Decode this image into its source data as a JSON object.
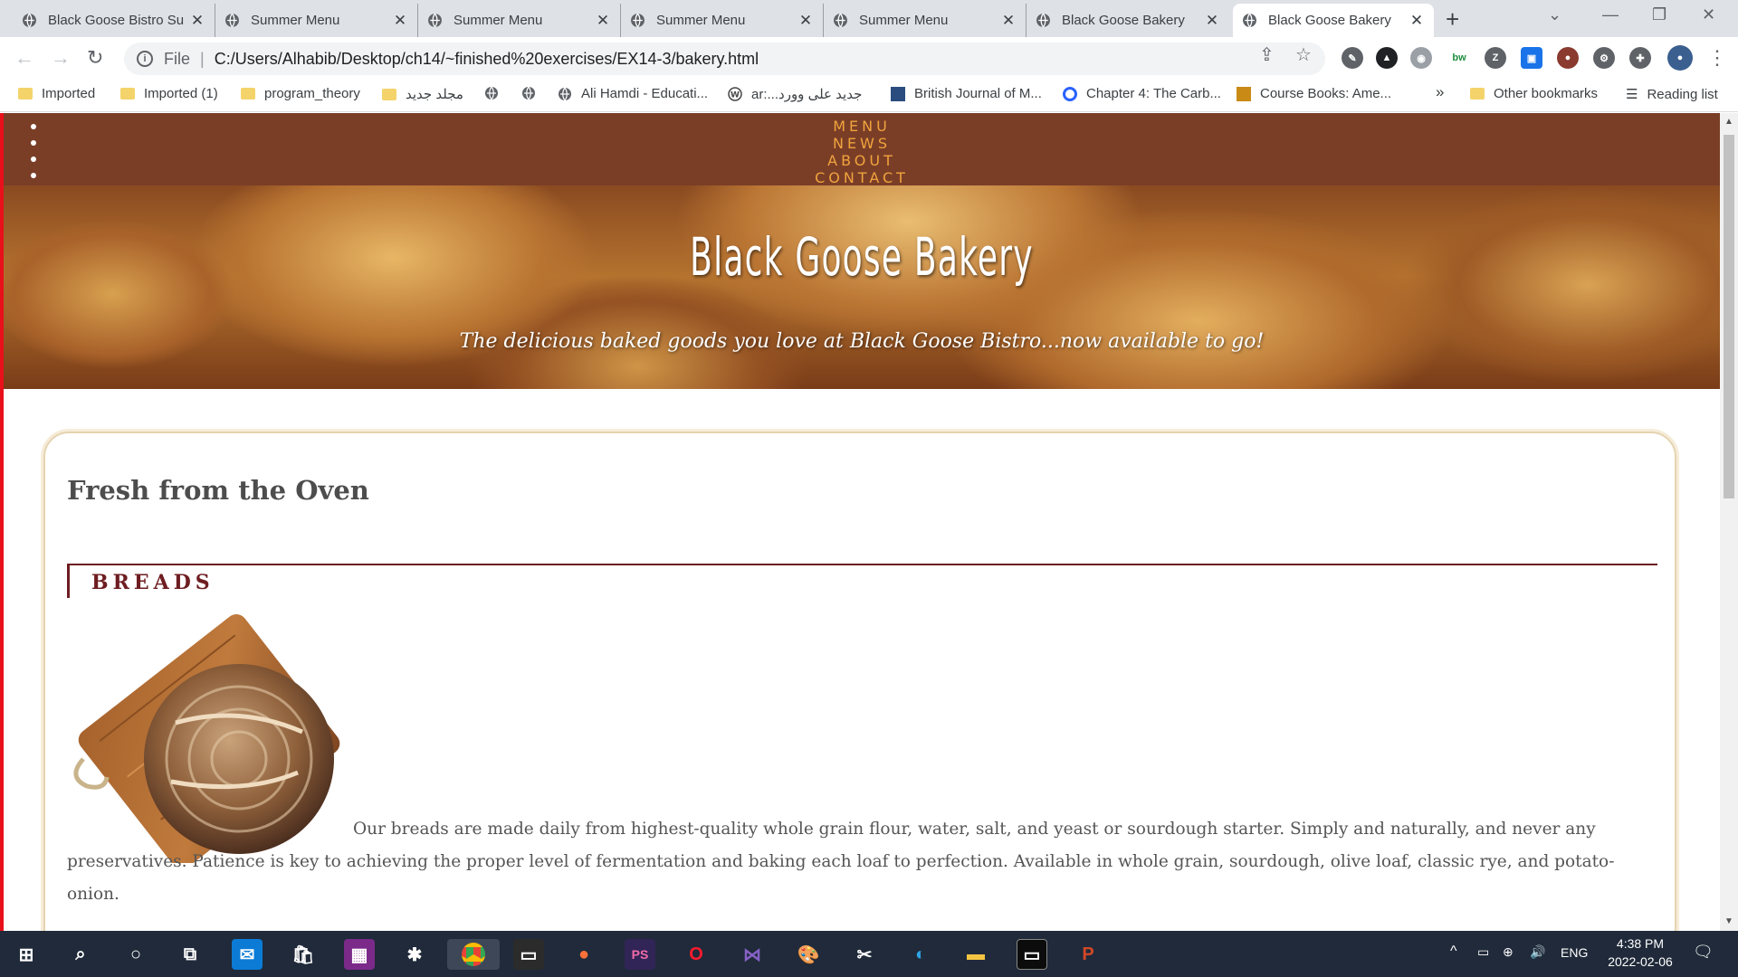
{
  "browser": {
    "tabs": [
      {
        "title": "Black Goose Bistro Su",
        "active": false
      },
      {
        "title": "Summer Menu",
        "active": false
      },
      {
        "title": "Summer Menu",
        "active": false
      },
      {
        "title": "Summer Menu",
        "active": false
      },
      {
        "title": "Summer Menu",
        "active": false
      },
      {
        "title": "Black Goose Bakery",
        "active": false
      },
      {
        "title": "Black Goose Bakery",
        "active": true
      }
    ],
    "new_tab_label": "+",
    "address": {
      "scheme_label": "File",
      "url": "C:/Users/Alhabib/Desktop/ch14/~finished%20exercises/EX14-3/bakery.html"
    },
    "bookmarks": [
      {
        "label": "Imported",
        "type": "folder"
      },
      {
        "label": "Imported (1)",
        "type": "folder"
      },
      {
        "label": "program_theory",
        "type": "folder"
      },
      {
        "label": "مجلد جديد",
        "type": "folder"
      },
      {
        "label": "",
        "type": "globe"
      },
      {
        "label": "",
        "type": "globe"
      },
      {
        "label": "Ali Hamdi - Educati...",
        "type": "globe"
      },
      {
        "label": "ar:...جديد على وورد",
        "type": "wp"
      },
      {
        "label": "British Journal of M...",
        "type": "site"
      },
      {
        "label": "Chapter 4: The Carb...",
        "type": "site"
      },
      {
        "label": "Course Books: Ame...",
        "type": "site"
      }
    ],
    "bookmarks_overflow": "»",
    "other_bookmarks": "Other bookmarks",
    "reading_list": "Reading list",
    "extensions": [
      {
        "text": "bw",
        "color": "#1e8e3e"
      },
      {
        "text": "Z",
        "color": "#555555"
      }
    ]
  },
  "site": {
    "nav": [
      "MENU",
      "NEWS",
      "ABOUT",
      "CONTACT"
    ],
    "hero_title": "Black Goose Bakery",
    "hero_tagline": "The delicious baked goods you love at Black Goose Bistro...now available to go!",
    "main_heading": "Fresh from the Oven",
    "section_label": "BREADS",
    "breads_text": "Our breads are made daily from highest-quality whole grain flour, water, salt, and yeast or sourdough starter. Simply and naturally, and never any preservatives. Patience is key to achieving the proper level of fermentation and baking each loaf to perfection. Available in whole grain, sourdough, olive loaf, classic rye, and potato-onion."
  },
  "taskbar": {
    "language": "ENG",
    "time": "4:38 PM",
    "date": "2022-02-06"
  }
}
